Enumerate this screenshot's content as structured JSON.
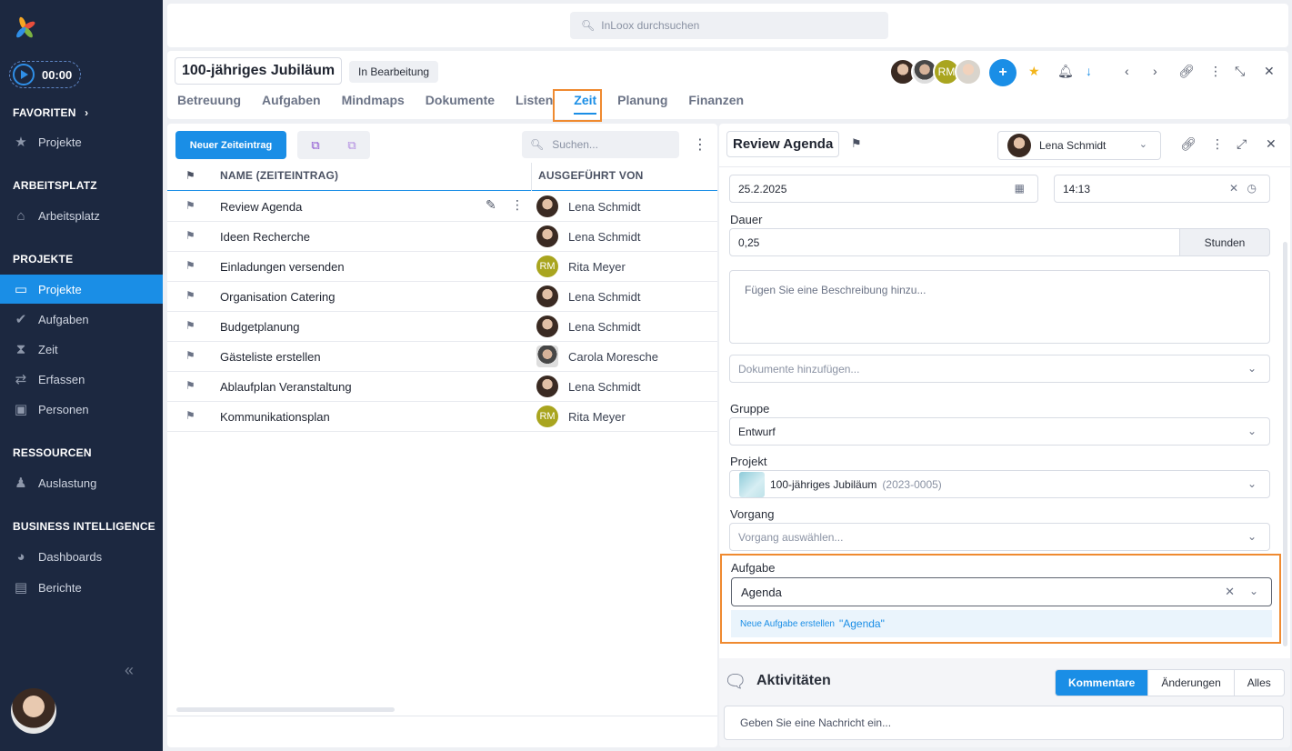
{
  "sidebar": {
    "timer": "00:00",
    "favorites_head": "FAVORITEN",
    "favorites_items": [
      {
        "label": "Projekte",
        "icon": "star-icon"
      }
    ],
    "arbeitsplatz_head": "ARBEITSPLATZ",
    "arbeitsplatz_items": [
      {
        "label": "Arbeitsplatz",
        "icon": "home-icon"
      }
    ],
    "projekte_head": "PROJEKTE",
    "projekte_items": [
      {
        "label": "Projekte",
        "icon": "folder-icon",
        "active": true
      },
      {
        "label": "Aufgaben",
        "icon": "check-circle-icon"
      },
      {
        "label": "Zeit",
        "icon": "hourglass-icon"
      },
      {
        "label": "Erfassen",
        "icon": "swap-icon"
      },
      {
        "label": "Personen",
        "icon": "contact-card-icon"
      }
    ],
    "ressourcen_head": "RESSOURCEN",
    "ressourcen_items": [
      {
        "label": "Auslastung",
        "icon": "person-load-icon"
      }
    ],
    "bi_head": "BUSINESS INTELLIGENCE",
    "bi_items": [
      {
        "label": "Dashboards",
        "icon": "pie-icon"
      },
      {
        "label": "Berichte",
        "icon": "report-icon"
      }
    ]
  },
  "search": {
    "placeholder": "InLoox durchsuchen"
  },
  "project": {
    "title": "100-jähriges Jubiläum",
    "status": "In Bearbeitung",
    "tabs": [
      "Betreuung",
      "Aufgaben",
      "Mindmaps",
      "Dokumente",
      "Listen",
      "Zeit",
      "Planung",
      "Finanzen"
    ],
    "active_tab": "Zeit",
    "avatar_initials": "RM"
  },
  "list": {
    "new_button": "Neuer Zeiteintrag",
    "search_placeholder": "Suchen...",
    "col_name": "NAME (ZEITEINTRAG)",
    "col_by": "AUSGEFÜHRT VON",
    "rows": [
      {
        "name": "Review Agenda",
        "by": "Lena Schmidt",
        "av": "ls",
        "initials": ""
      },
      {
        "name": "Ideen Recherche",
        "by": "Lena Schmidt",
        "av": "ls",
        "initials": ""
      },
      {
        "name": "Einladungen versenden",
        "by": "Rita Meyer",
        "av": "rm",
        "initials": "RM"
      },
      {
        "name": "Organisation Catering",
        "by": "Lena Schmidt",
        "av": "ls",
        "initials": ""
      },
      {
        "name": "Budgetplanung",
        "by": "Lena Schmidt",
        "av": "ls",
        "initials": ""
      },
      {
        "name": "Gästeliste erstellen",
        "by": "Carola Moresche",
        "av": "cm",
        "initials": ""
      },
      {
        "name": "Ablaufplan Veranstaltung",
        "by": "Lena Schmidt",
        "av": "ls",
        "initials": ""
      },
      {
        "name": "Kommunikationsplan",
        "by": "Rita Meyer",
        "av": "rm",
        "initials": "RM"
      }
    ]
  },
  "detail": {
    "title": "Review Agenda",
    "assignee": "Lena Schmidt",
    "date": "25.2.2025",
    "time": "14:13",
    "dauer_label": "Dauer",
    "dauer_value": "0,25",
    "dauer_unit": "Stunden",
    "desc_placeholder": "Fügen Sie eine Beschreibung hinzu...",
    "docs_placeholder": "Dokumente hinzufügen...",
    "gruppe_label": "Gruppe",
    "gruppe_value": "Entwurf",
    "projekt_label": "Projekt",
    "projekt_value": "100-jähriges Jubiläum",
    "projekt_code": "(2023-0005)",
    "vorgang_label": "Vorgang",
    "vorgang_placeholder": "Vorgang auswählen...",
    "aufgabe_label": "Aufgabe",
    "aufgabe_value": "Agenda",
    "suggest_prefix": "Neue Aufgabe erstellen",
    "suggest_value": "\"Agenda\""
  },
  "activities": {
    "title": "Aktivitäten",
    "tabs": [
      "Kommentare",
      "Änderungen",
      "Alles"
    ],
    "active_tab": "Kommentare",
    "message_placeholder": "Geben Sie eine Nachricht ein..."
  },
  "colors": {
    "accent": "#1a8ee6",
    "sidebar": "#1c2840",
    "highlight": "#ef8a30",
    "rm_avatar": "#a9a51f"
  }
}
